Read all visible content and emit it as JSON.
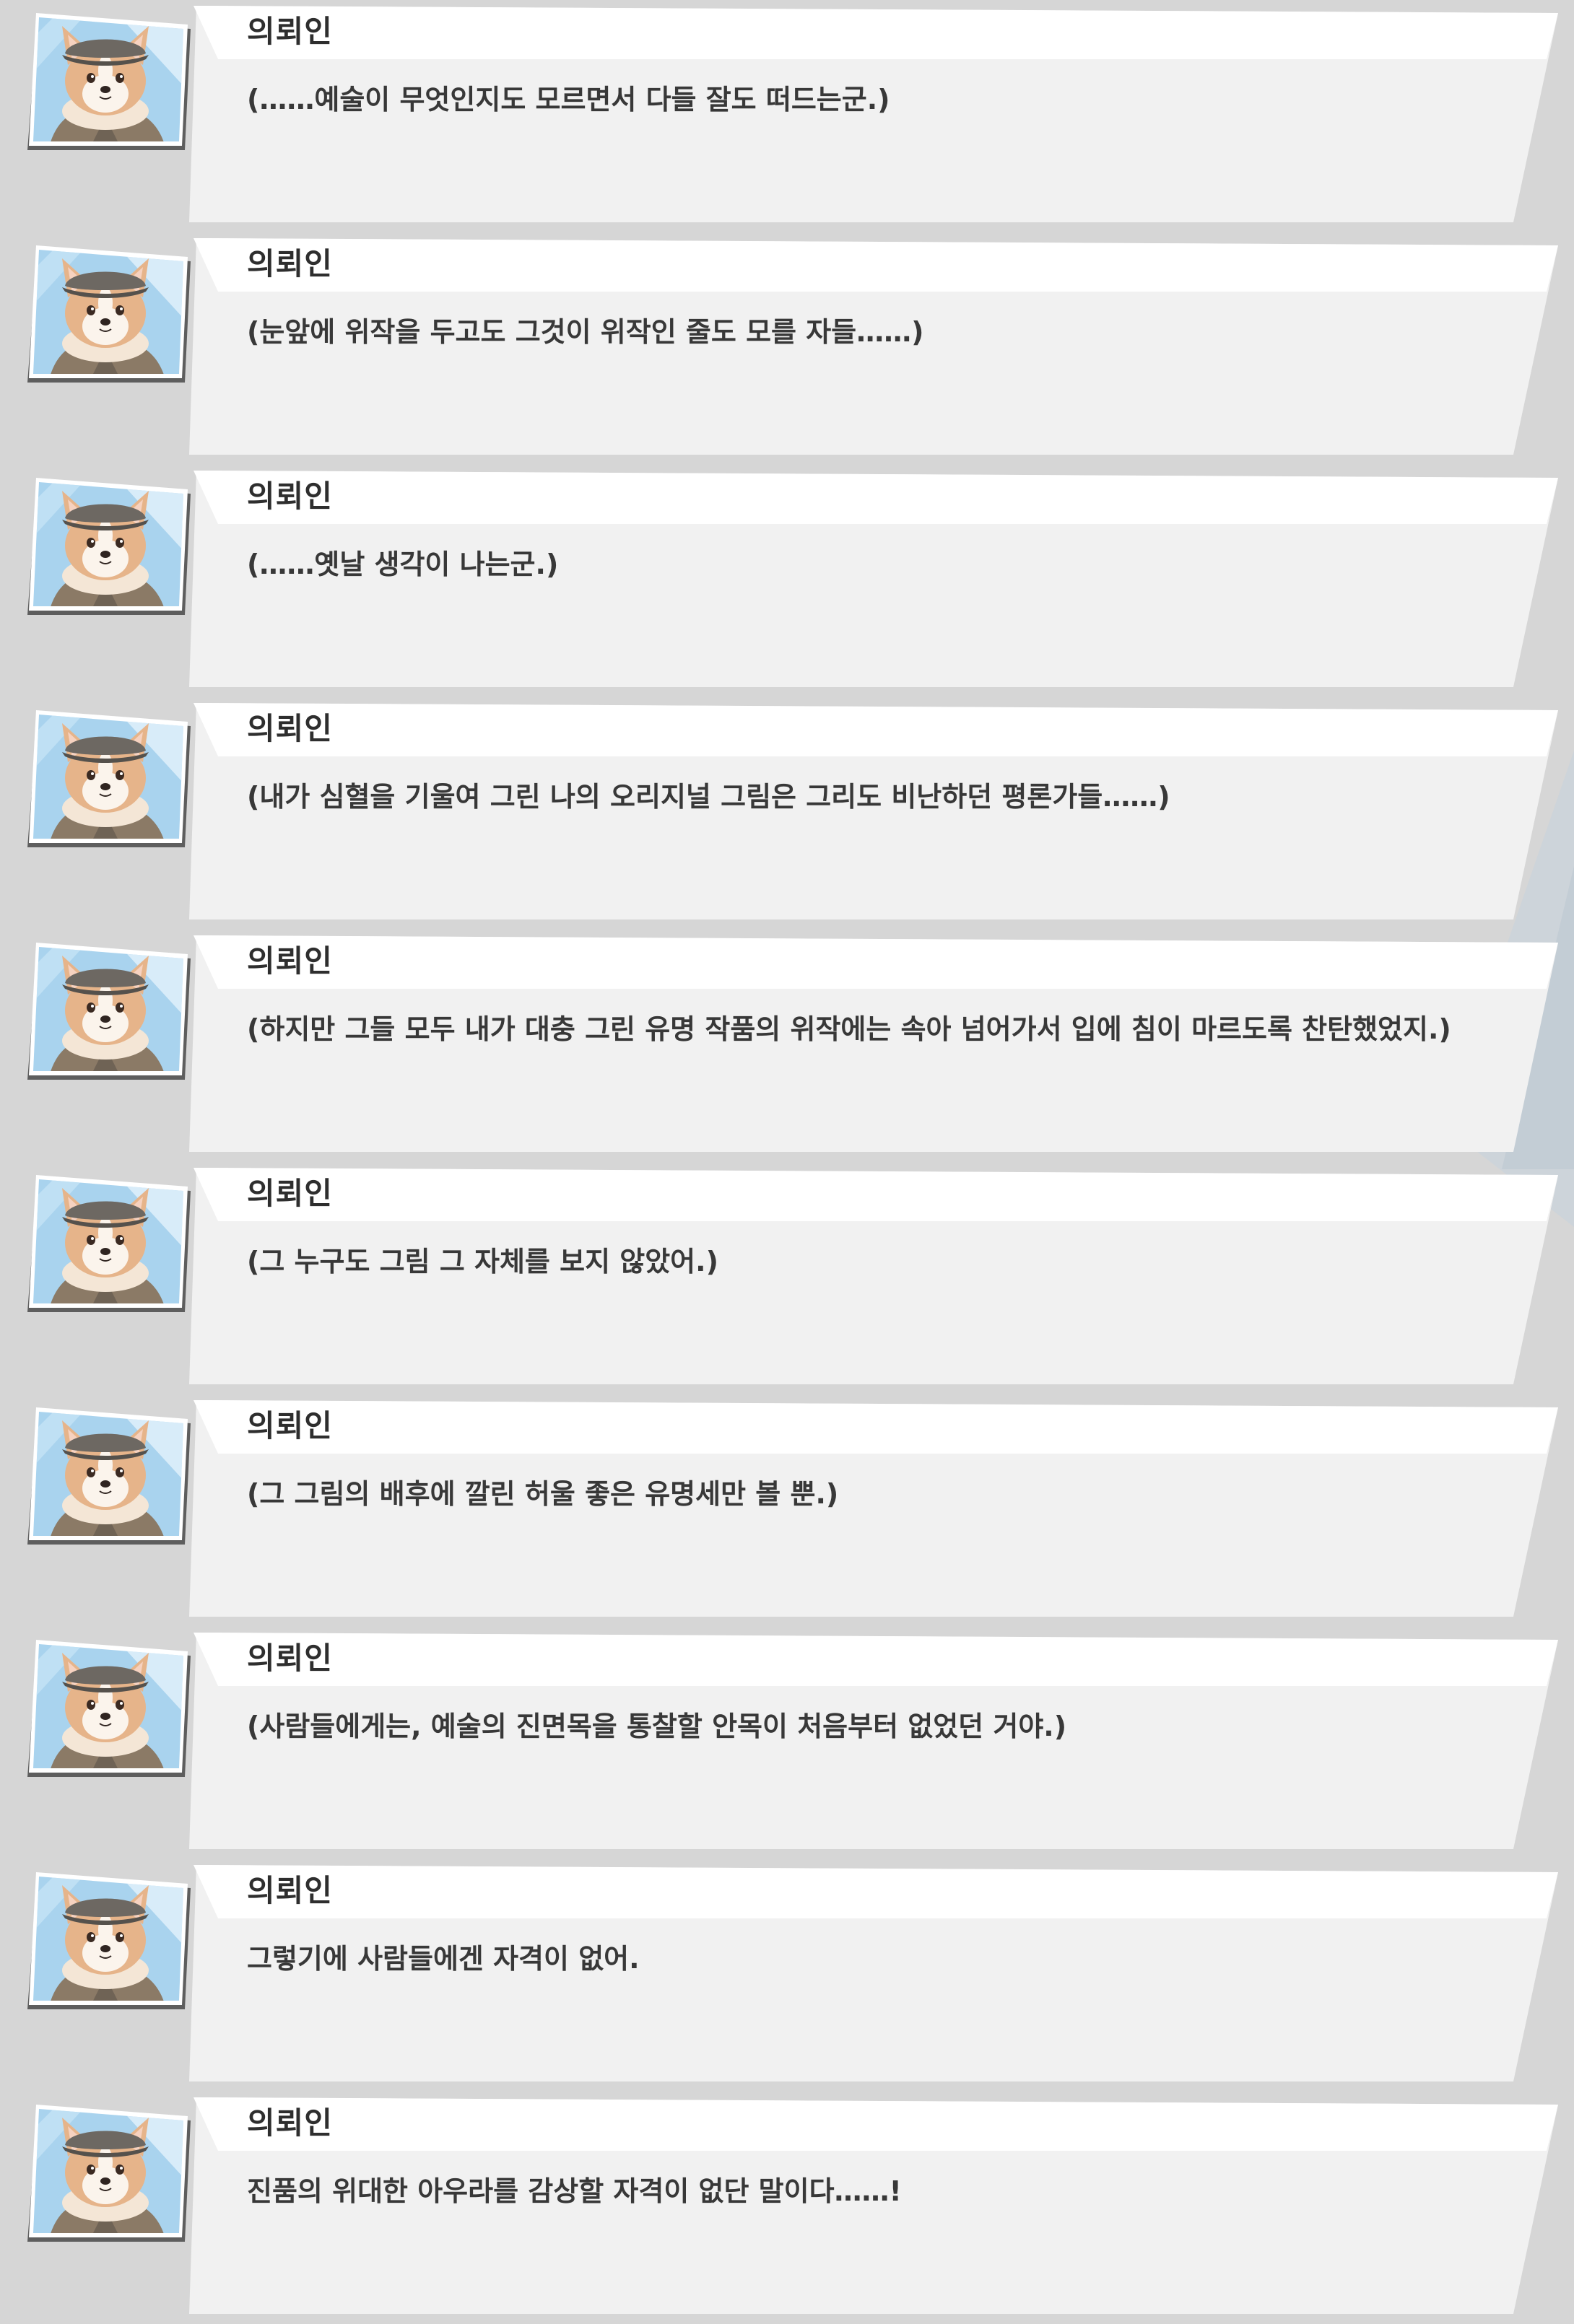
{
  "colors": {
    "background": "#d6d6d6",
    "bubble_header": "#ffffff",
    "bubble_body": "#f1f1f1",
    "speaker_text": "#2e2e2e",
    "dialogue_text": "#383838",
    "portrait_sky": "#a9d3ee",
    "portrait_frame": "#5a5a5a"
  },
  "dialogues": [
    {
      "speaker": "의뢰인",
      "portrait": "corgi-client-portrait",
      "text": "(……예술이 무엇인지도 모르면서 다들 잘도 떠드는군.)"
    },
    {
      "speaker": "의뢰인",
      "portrait": "corgi-client-portrait",
      "text": "(눈앞에 위작을 두고도 그것이 위작인 줄도 모를 자들……)"
    },
    {
      "speaker": "의뢰인",
      "portrait": "corgi-client-portrait",
      "text": "(……옛날 생각이 나는군.)"
    },
    {
      "speaker": "의뢰인",
      "portrait": "corgi-client-portrait",
      "text": "(내가 심혈을 기울여 그린 나의 오리지널 그림은 그리도 비난하던 평론가들……)"
    },
    {
      "speaker": "의뢰인",
      "portrait": "corgi-client-portrait",
      "text": "(하지만 그들 모두 내가 대충 그린 유명 작품의 위작에는 속아 넘어가서 입에 침이 마르도록 찬탄했었지.)"
    },
    {
      "speaker": "의뢰인",
      "portrait": "corgi-client-portrait",
      "text": "(그 누구도 그림 그 자체를 보지 않았어.)"
    },
    {
      "speaker": "의뢰인",
      "portrait": "corgi-client-portrait",
      "text": "(그 그림의 배후에 깔린 허울 좋은 유명세만 볼 뿐.)"
    },
    {
      "speaker": "의뢰인",
      "portrait": "corgi-client-portrait",
      "text": "(사람들에게는, 예술의 진면목을 통찰할 안목이 처음부터 없었던 거야.)"
    },
    {
      "speaker": "의뢰인",
      "portrait": "corgi-client-portrait",
      "text": "그렇기에 사람들에겐 자격이 없어."
    },
    {
      "speaker": "의뢰인",
      "portrait": "corgi-client-portrait",
      "text": "진품의 위대한 아우라를 감상할 자격이 없단 말이다……!"
    }
  ]
}
